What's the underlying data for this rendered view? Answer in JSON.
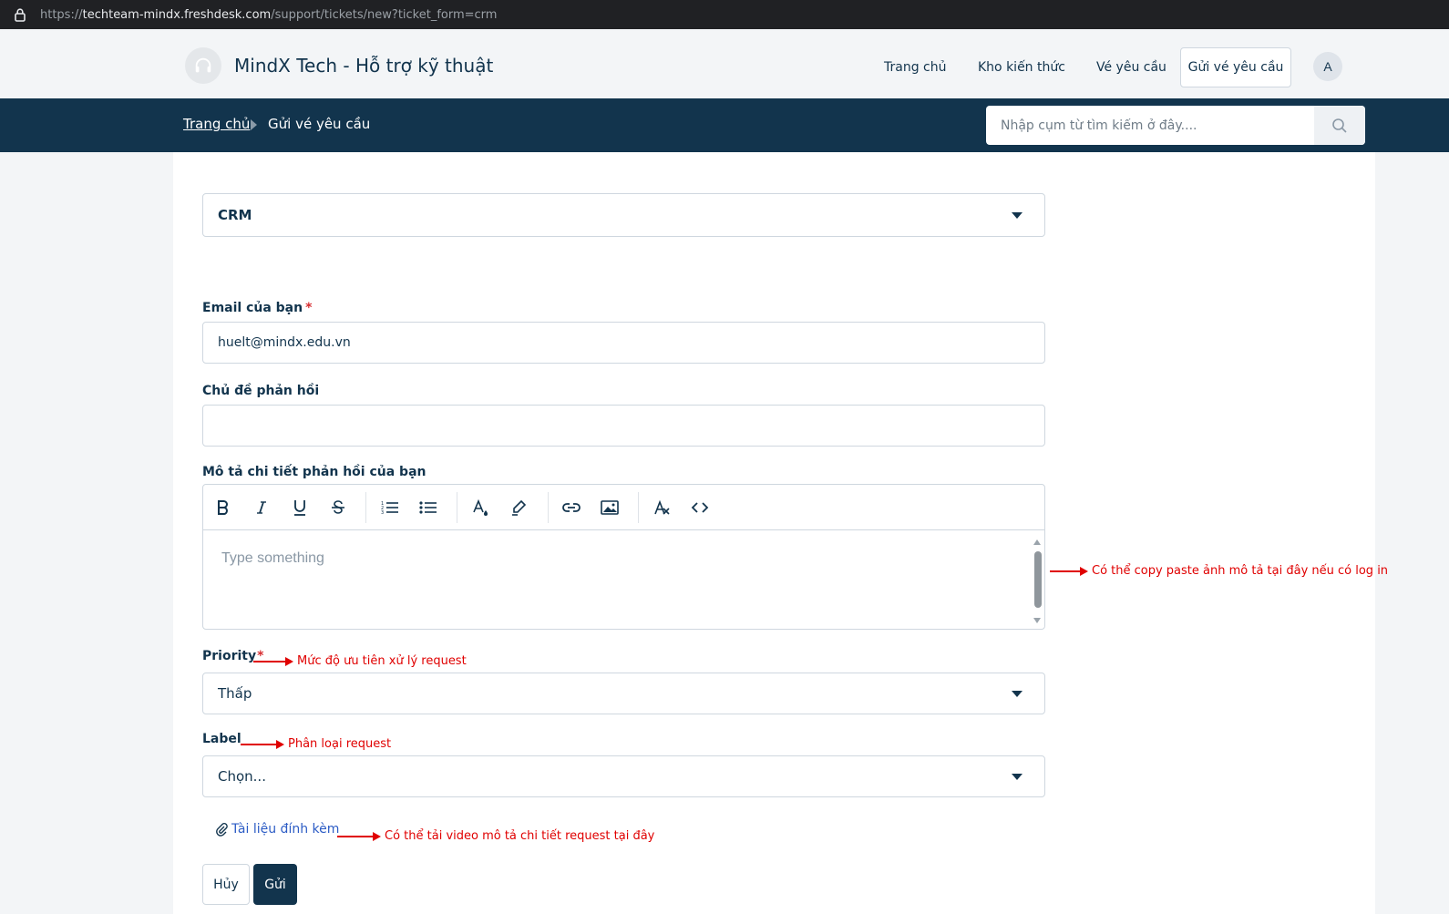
{
  "browser": {
    "url_prefix": "https://",
    "url_host": "techteam-mindx.freshdesk.com",
    "url_path": "/support/tickets/new?ticket_form=crm"
  },
  "header": {
    "brand": "MindX Tech - Hỗ trợ kỹ thuật",
    "nav": {
      "home": "Trang chủ",
      "knowledge_base": "Kho kiến thức",
      "tickets": "Vé yêu cầu",
      "submit_ticket": "Gửi vé yêu cầu"
    },
    "avatar_initial": "A"
  },
  "breadcrumb": {
    "home": "Trang chủ",
    "current": "Gửi vé yêu cầu"
  },
  "search": {
    "placeholder": "Nhập cụm từ tìm kiếm ở đây...."
  },
  "form": {
    "ticket_type": "CRM",
    "email_label": "Email của bạn",
    "required_mark": "*",
    "email_value": "huelt@mindx.edu.vn",
    "subject_label": "Chủ đề phản hồi",
    "subject_value": "",
    "description_label": "Mô tả chi tiết phản hồi của bạn",
    "description_placeholder": "Type something",
    "priority_label": "Priority",
    "priority_value": "Thấp",
    "label_label": "Label",
    "label_value": "Chọn...",
    "attachment": "Tài liệu đính kèm",
    "cancel": "Hủy",
    "submit": "Gửi"
  },
  "annotations": {
    "editor": "Có thể copy paste ảnh mô tả tại đây nếu có log in",
    "priority": "Mức độ ưu tiên xử lý request",
    "label": "Phân loại request",
    "attachment": "Có thể tải video mô tả chi tiết request tại đây"
  },
  "colors": {
    "primary": "#12344d",
    "annotation": "#e00000",
    "link": "#2c5cc5",
    "required": "#d72d30"
  }
}
